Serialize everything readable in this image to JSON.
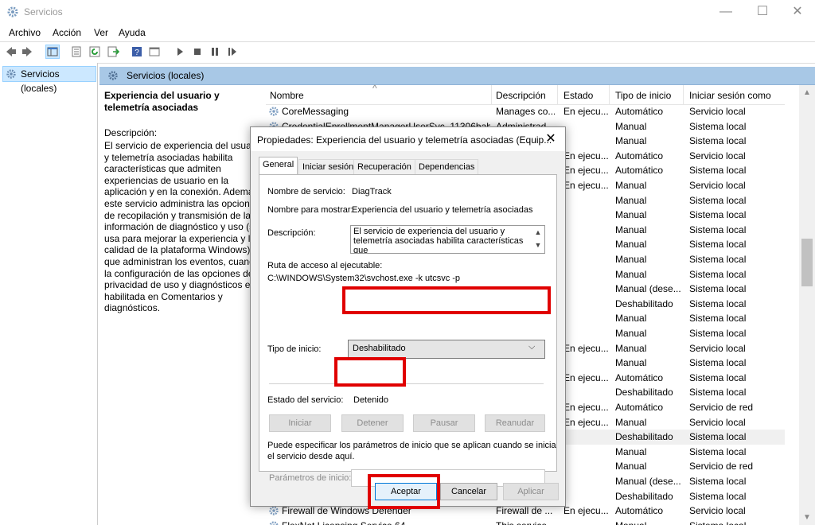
{
  "window": {
    "title": "Servicios",
    "icons": {
      "app": "gear-icon",
      "minimize": "minimize-icon",
      "maximize": "maximize-icon",
      "close": "close-icon"
    }
  },
  "menu": [
    {
      "label": "Archivo"
    },
    {
      "label": "Acción"
    },
    {
      "label": "Ver"
    },
    {
      "label": "Ayuda"
    }
  ],
  "toolbar": {
    "icons": [
      "back-arrow-icon",
      "forward-arrow-icon",
      "console-tree-icon",
      "properties-icon",
      "refresh-icon",
      "export-list-icon",
      "help-icon",
      "console-icon",
      "play-icon",
      "stop-icon",
      "pause-icon",
      "restart-icon"
    ]
  },
  "tree": {
    "item": "Servicios (locales)"
  },
  "panel": {
    "title": "Servicios (locales)"
  },
  "description_pane": {
    "service_name": "Experiencia del usuario y telemetría asociadas",
    "label": "Descripción:",
    "text": "El servicio de experiencia del usuario\ny telemetría asociadas habilita\ncaracterísticas que admiten\nexperiencias de usuario en la\naplicación y en la conexión. Además,\neste servicio administra las opciones\nde recopilación y transmisión de la\ninformación de diagnóstico y uso (si\nusa para mejorar la experiencia y la\ncalidad de la plataforma Windows)\nque administran los eventos, cuando\nla configuración de las opciones de\nprivacidad de uso y diagnósticos está\nhabilitada en Comentarios y\ndiagnósticos."
  },
  "list": {
    "sort_indicator": "^",
    "columns": [
      "Nombre",
      "Descripción",
      "Estado",
      "Tipo de inicio",
      "Iniciar sesión como"
    ],
    "rows": [
      {
        "name": "CoreMessaging",
        "desc": "Manages co...",
        "state": "En ejecu...",
        "start": "Automático",
        "logon": "Servicio local"
      },
      {
        "name": "CredentialEnrollmentManagerUserSvc_11306bab",
        "desc": "Administrad...",
        "state": "",
        "start": "Manual",
        "logon": "Sistema local"
      },
      {
        "name": "",
        "desc": "",
        "state": "",
        "start": "Manual",
        "logon": "Sistema local"
      },
      {
        "name": "",
        "desc": "",
        "state": "En ejecu...",
        "start": "Automático",
        "logon": "Servicio local"
      },
      {
        "name": "",
        "desc": "",
        "state": "En ejecu...",
        "start": "Automático",
        "logon": "Sistema local"
      },
      {
        "name": "",
        "desc": "",
        "state": "En ejecu...",
        "start": "Manual",
        "logon": "Servicio local"
      },
      {
        "name": "",
        "desc": "",
        "state": "",
        "start": "Manual",
        "logon": "Sistema local"
      },
      {
        "name": "",
        "desc": "",
        "state": "",
        "start": "Manual",
        "logon": "Sistema local"
      },
      {
        "name": "",
        "desc": "",
        "state": "",
        "start": "Manual",
        "logon": "Sistema local"
      },
      {
        "name": "",
        "desc": "",
        "state": "",
        "start": "Manual",
        "logon": "Sistema local"
      },
      {
        "name": "",
        "desc": "",
        "state": "",
        "start": "Manual",
        "logon": "Sistema local"
      },
      {
        "name": "",
        "desc": "",
        "state": "",
        "start": "Manual",
        "logon": "Sistema local"
      },
      {
        "name": "",
        "desc": "",
        "state": "",
        "start": "Manual (dese...",
        "logon": "Sistema local"
      },
      {
        "name": "",
        "desc": "",
        "state": "",
        "start": "Deshabilitado",
        "logon": "Sistema local"
      },
      {
        "name": "",
        "desc": "",
        "state": "",
        "start": "Manual",
        "logon": "Sistema local"
      },
      {
        "name": "",
        "desc": "",
        "state": "",
        "start": "Manual",
        "logon": "Sistema local"
      },
      {
        "name": "",
        "desc": "",
        "state": "En ejecu...",
        "start": "Manual",
        "logon": "Servicio local"
      },
      {
        "name": "",
        "desc": "",
        "state": "",
        "start": "Manual",
        "logon": "Sistema local"
      },
      {
        "name": "",
        "desc": "",
        "state": "En ejecu...",
        "start": "Automático",
        "logon": "Sistema local"
      },
      {
        "name": "",
        "desc": "",
        "state": "",
        "start": "Deshabilitado",
        "logon": "Sistema local"
      },
      {
        "name": "",
        "desc": "",
        "state": "En ejecu...",
        "start": "Automático",
        "logon": "Servicio de red"
      },
      {
        "name": "",
        "desc": "",
        "state": "En ejecu...",
        "start": "Manual",
        "logon": "Servicio local"
      },
      {
        "name": "",
        "desc": "",
        "state": "",
        "start": "Deshabilitado",
        "logon": "Sistema local",
        "selected": true
      },
      {
        "name": "",
        "desc": "",
        "state": "",
        "start": "Manual",
        "logon": "Sistema local"
      },
      {
        "name": "",
        "desc": "",
        "state": "",
        "start": "Manual",
        "logon": "Servicio de red"
      },
      {
        "name": "",
        "desc": "",
        "state": "",
        "start": "Manual (dese...",
        "logon": "Sistema local"
      },
      {
        "name": "",
        "desc": "",
        "state": "",
        "start": "Deshabilitado",
        "logon": "Sistema local"
      },
      {
        "name": "Firewall de Windows Defender",
        "desc": "Firewall de ...",
        "state": "En ejecu...",
        "start": "Automático",
        "logon": "Servicio local"
      },
      {
        "name": "FlexNet Licensing Service 64",
        "desc": "This service...",
        "state": "",
        "start": "Manual",
        "logon": "Sistema local"
      }
    ]
  },
  "dialog": {
    "title": "Propiedades: Experiencia del usuario y telemetría asociadas (Equip...",
    "close": "✕",
    "tabs": [
      "General",
      "Iniciar sesión",
      "Recuperación",
      "Dependencias"
    ],
    "service_name_label": "Nombre de servicio:",
    "service_name": "DiagTrack",
    "display_name_label": "Nombre para mostrar:",
    "display_name": "Experiencia del usuario y telemetría asociadas",
    "description_label": "Descripción:",
    "description": "El servicio de experiencia del usuario y\ntelemetría asociadas habilita características que\nadmiten experiencias de usuario en la aplicación",
    "path_label": "Ruta de acceso al ejecutable:",
    "path": "C:\\WINDOWS\\System32\\svchost.exe -k utcsvc -p",
    "startup_label": "Tipo de inicio:",
    "startup_value": "Deshabilitado",
    "status_label": "Estado del servicio:",
    "status_value": "Detenido",
    "buttons": {
      "start": "Iniciar",
      "stop": "Detener",
      "pause": "Pausar",
      "resume": "Reanudar"
    },
    "params_hint": "Puede especificar los parámetros de inicio que se aplican cuando se inicia\nel servicio desde aquí.",
    "params_label": "Parámetros de inicio:",
    "params_value": "",
    "ok": "Aceptar",
    "cancel": "Cancelar",
    "apply": "Aplicar"
  },
  "highlight_color": "#e00000"
}
